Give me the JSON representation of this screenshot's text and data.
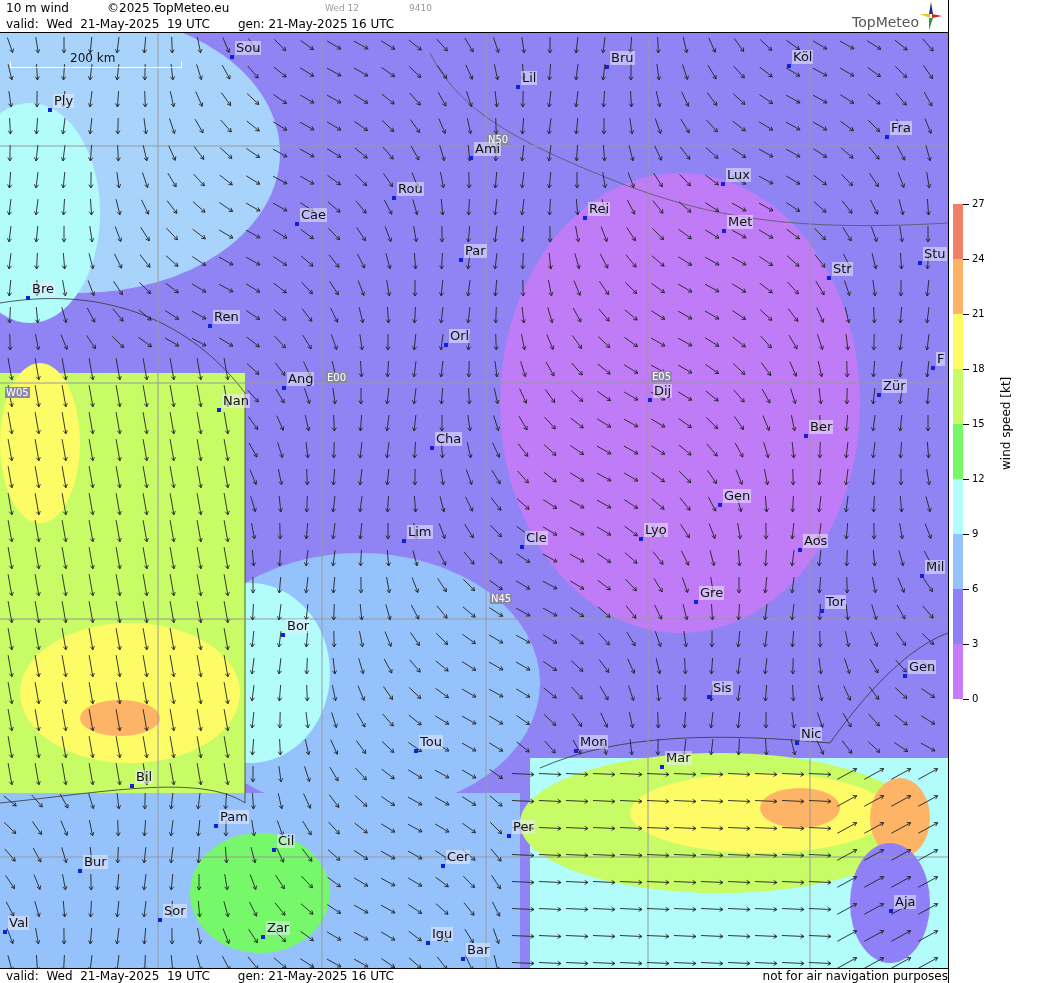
{
  "header": {
    "title": "10 m wind",
    "copyright": "©2025 TopMeteo.eu",
    "run_label": "Wed 12",
    "code": "9410",
    "valid": "valid:  Wed  21-May-2025  19 UTC",
    "generated": "gen: 21-May-2025 16 UTC",
    "logo": "TopMeteo"
  },
  "map": {
    "scale": "200 km",
    "grid_labels": [
      "N50",
      "W05",
      "E00",
      "E05",
      "N45"
    ],
    "cities": [
      {
        "name": "Sou"
      },
      {
        "name": "Ply"
      },
      {
        "name": "Lil"
      },
      {
        "name": "Bru"
      },
      {
        "name": "Köl"
      },
      {
        "name": "Fra"
      },
      {
        "name": "Ami"
      },
      {
        "name": "Lux"
      },
      {
        "name": "Rou"
      },
      {
        "name": "Cae"
      },
      {
        "name": "Rei"
      },
      {
        "name": "Met"
      },
      {
        "name": "Par"
      },
      {
        "name": "Str"
      },
      {
        "name": "Stu"
      },
      {
        "name": "Bre"
      },
      {
        "name": "Ren"
      },
      {
        "name": "Orl"
      },
      {
        "name": "F"
      },
      {
        "name": "Ang"
      },
      {
        "name": "Nan"
      },
      {
        "name": "Dij"
      },
      {
        "name": "Zür"
      },
      {
        "name": "Ber"
      },
      {
        "name": "Cha"
      },
      {
        "name": "Gen"
      },
      {
        "name": "Lim"
      },
      {
        "name": "Cle"
      },
      {
        "name": "Lyo"
      },
      {
        "name": "Aos"
      },
      {
        "name": "Mil"
      },
      {
        "name": "Gre"
      },
      {
        "name": "Tor"
      },
      {
        "name": "Bor"
      },
      {
        "name": "Gen"
      },
      {
        "name": "Sis"
      },
      {
        "name": "Nic"
      },
      {
        "name": "Tou"
      },
      {
        "name": "Mon"
      },
      {
        "name": "Mar"
      },
      {
        "name": "Bil"
      },
      {
        "name": "Pam"
      },
      {
        "name": "Per"
      },
      {
        "name": "Cil"
      },
      {
        "name": "Aja"
      },
      {
        "name": "Cer"
      },
      {
        "name": "Bur"
      },
      {
        "name": "Sor"
      },
      {
        "name": "Val"
      },
      {
        "name": "Zar"
      },
      {
        "name": "Igu"
      },
      {
        "name": "Bar"
      }
    ]
  },
  "legend": {
    "title": "wind speed [kt]",
    "ticks": [
      "27",
      "24",
      "21",
      "18",
      "15",
      "12",
      "9",
      "6",
      "3",
      "0"
    ],
    "bands": [
      {
        "color": "#f18068"
      },
      {
        "color": "#fdb466"
      },
      {
        "color": "#fdfc66"
      },
      {
        "color": "#c7fc66"
      },
      {
        "color": "#76f86a"
      },
      {
        "color": "#b2fcfc"
      },
      {
        "color": "#96c2fc"
      },
      {
        "color": "#8f80f7"
      },
      {
        "color": "#c67cf8"
      }
    ]
  },
  "footer": {
    "valid": "valid:  Wed  21-May-2025  19 UTC",
    "generated": "gen: 21-May-2025 16 UTC",
    "disclaimer": "not for air navigation purposes"
  }
}
